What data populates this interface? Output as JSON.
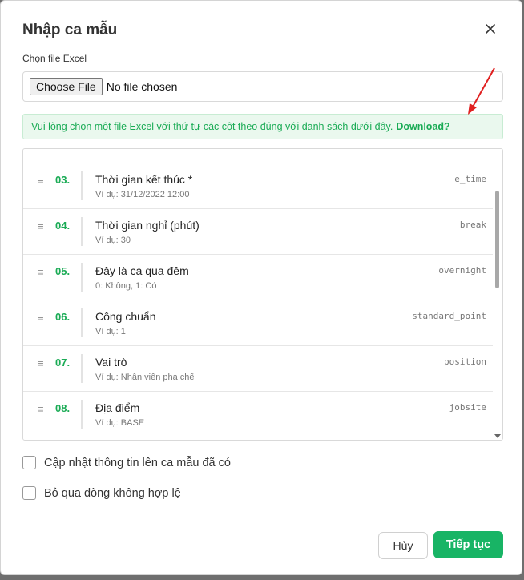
{
  "dialog": {
    "title": "Nhập ca mẫu",
    "close_icon": "close-icon"
  },
  "file_field": {
    "label": "Chọn file Excel",
    "button_label": "Choose File",
    "status": "No file chosen"
  },
  "notice": {
    "text": "Vui lòng chọn một file Excel với thứ tự các cột theo đúng với danh sách dưới đây.",
    "link": "Download?",
    "color": "#1aab55"
  },
  "columns": [
    {
      "num": "03.",
      "title": "Thời gian kết thúc *",
      "example": "Ví dụ: 31/12/2022 12:00",
      "code": "e_time"
    },
    {
      "num": "04.",
      "title": "Thời gian nghỉ (phút)",
      "example": "Ví dụ: 30",
      "code": "break"
    },
    {
      "num": "05.",
      "title": "Đây là ca qua đêm",
      "example": "0: Không, 1: Có",
      "code": "overnight"
    },
    {
      "num": "06.",
      "title": "Công chuẩn",
      "example": "Ví dụ: 1",
      "code": "standard_point"
    },
    {
      "num": "07.",
      "title": "Vai trò",
      "example": "Ví dụ: Nhân viên pha chế",
      "code": "position"
    },
    {
      "num": "08.",
      "title": "Địa điểm",
      "example": "Ví dụ: BASE",
      "code": "jobsite"
    }
  ],
  "options": {
    "update_existing": "Cập nhật thông tin lên ca mẫu đã có",
    "skip_invalid": "Bỏ qua dòng không hợp lệ"
  },
  "footer": {
    "cancel": "Hủy",
    "continue": "Tiếp tục",
    "accent": "#18b465"
  }
}
